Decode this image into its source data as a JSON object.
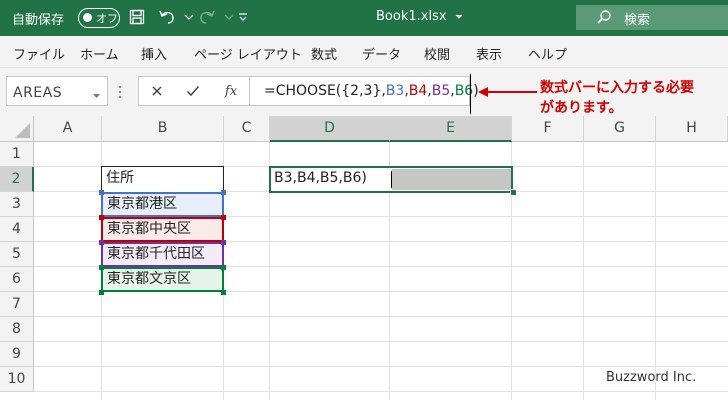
{
  "title_bar": {
    "autosave_label": "自動保存",
    "autosave_state": "オフ",
    "filename": "Book1.xlsx",
    "search_label": "検索"
  },
  "ribbon": {
    "tabs": [
      "ファイル",
      "ホーム",
      "挿入",
      "ページ レイアウト",
      "数式",
      "データ",
      "校閲",
      "表示",
      "ヘルプ"
    ]
  },
  "formula_bar": {
    "name_box": "AREAS",
    "fx_label": "fx",
    "formula_parts": [
      {
        "text": "=CHOOSE({2,3},",
        "color": "#222222"
      },
      {
        "text": "B3",
        "color": "#4472c4"
      },
      {
        "text": ",",
        "color": "#222222"
      },
      {
        "text": "B4",
        "color": "#c00000"
      },
      {
        "text": ",",
        "color": "#222222"
      },
      {
        "text": "B5",
        "color": "#7030a0"
      },
      {
        "text": ",",
        "color": "#222222"
      },
      {
        "text": "B6",
        "color": "#00803c"
      },
      {
        "text": ")",
        "color": "#222222"
      }
    ]
  },
  "annotation": {
    "line1": "数式バーに入力する必要",
    "line2": "があります。",
    "color": "#d00000"
  },
  "grid": {
    "columns": [
      "A",
      "B",
      "C",
      "D",
      "E",
      "F",
      "G",
      "H"
    ],
    "selected_columns": [
      "D",
      "E"
    ],
    "rows": [
      "1",
      "2",
      "3",
      "4",
      "5",
      "6",
      "7",
      "8",
      "9",
      "10"
    ],
    "selected_row": "2",
    "cells": {
      "B2": "住所",
      "B3": "東京都港区",
      "B4": "東京都中央区",
      "B5": "東京都千代田区",
      "B6": "東京都文京区",
      "D2": "B3,B4,B5,B6)"
    },
    "ref_colors": {
      "B3": "#4472c4",
      "B4": "#c00000",
      "B5": "#7030a0",
      "B6": "#00803c"
    }
  },
  "watermark": "Buzzword Inc."
}
